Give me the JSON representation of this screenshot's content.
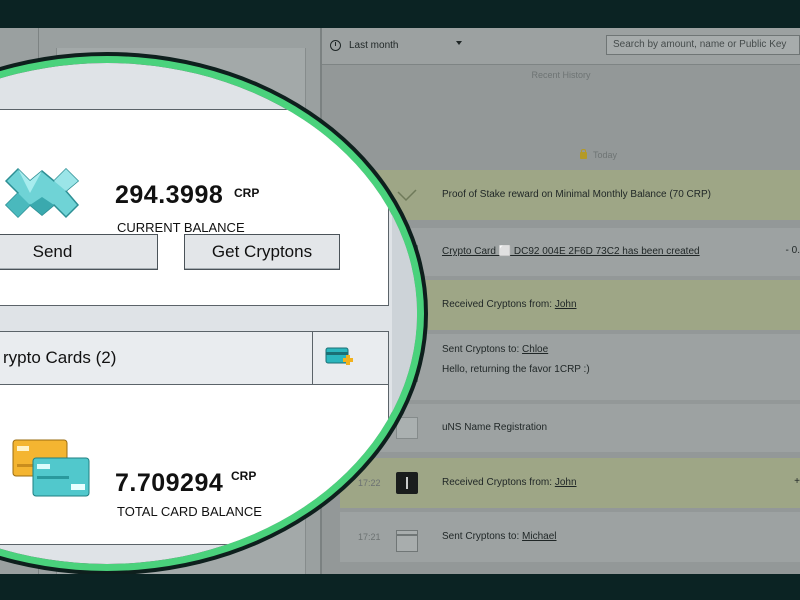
{
  "history": {
    "period_label": "Last month",
    "search_placeholder": "Search by amount, name or Public Key",
    "section_title": "Recent History",
    "today_label": "Today",
    "transactions": [
      {
        "time": "",
        "text_plain": "Proof of Stake reward on Minimal Monthly Balance (70 CRP)",
        "text_link": "",
        "note": "",
        "amount": "",
        "icon": "magic-wand-icon",
        "tone": "green"
      },
      {
        "time": "",
        "text_plain": "",
        "text_link": "Crypto Card ⬜ DC92 004E 2F6D 73C2 has been created",
        "note": "",
        "amount": "- 0.",
        "icon": "card-icon",
        "tone": "gray"
      },
      {
        "time": "",
        "text_plain": "Received Cryptons from: ",
        "text_link": "John",
        "note": "",
        "amount": "",
        "icon": "card-icon",
        "tone": "green"
      },
      {
        "time": "",
        "text_plain": "Sent Cryptons to: ",
        "text_link": "Chloe",
        "note": "Hello, returning the favor 1CRP :)",
        "amount": "",
        "icon": "card-icon",
        "tone": "gray"
      },
      {
        "time": "",
        "text_plain": "uNS Name Registration",
        "text_link": "",
        "note": "",
        "amount": "",
        "icon": "book-icon",
        "tone": "gray"
      },
      {
        "time": "17:22",
        "text_plain": "Received Cryptons from: ",
        "text_link": "John",
        "note": "",
        "amount": "+",
        "icon": "device-icon",
        "tone": "green"
      },
      {
        "time": "17:21",
        "text_plain": "Sent Cryptons to: ",
        "text_link": "Michael",
        "note": "",
        "amount": "",
        "icon": "card-icon",
        "tone": "gray"
      }
    ]
  },
  "wallet": {
    "balance_value": "294.3998",
    "balance_unit": "CRP",
    "balance_label": "CURRENT BALANCE",
    "send_label": "Send",
    "get_label": "Get Cryptons",
    "cards_title": "rypto Cards (2)",
    "card_total_value": "7.709294",
    "card_total_unit": "CRP",
    "card_total_label": "TOTAL CARD BALANCE"
  },
  "colors": {
    "accent_ring": "#4ad27c",
    "frame": "#0b2323",
    "crystal": "#6fd3d6",
    "card_gold": "#f4b531",
    "card_teal": "#51c8cc"
  }
}
